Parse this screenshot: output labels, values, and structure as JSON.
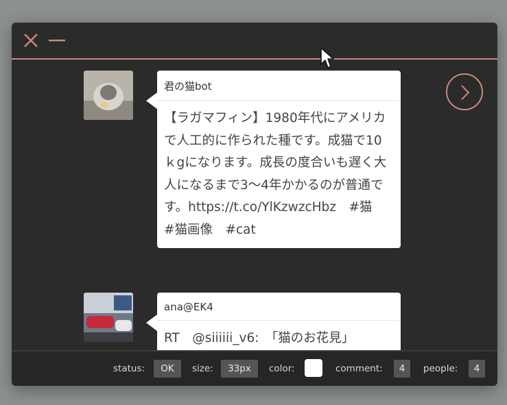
{
  "window": {
    "close_icon": "close-icon",
    "minimize_icon": "minimize-icon",
    "next_icon": "chevron-right-icon"
  },
  "tweets": [
    {
      "author": "君の猫bot",
      "text": "【ラガマフィン】1980年代にアメリカで人工的に作られた種です。成猫で10ｋgになります。成長の度合いも遅く大人になるまで3～4年かかるのが普通です。https://t.co/YlKzwzcHbz　#猫　#猫画像　#cat"
    },
    {
      "author": "ana@EK4",
      "text": "RT　@siiiiii_v6:　「猫のお花見」"
    }
  ],
  "status": {
    "status_label": "status:",
    "status_value": "OK",
    "size_label": "size:",
    "size_value": "33px",
    "color_label": "color:",
    "color_value": "#ffffff",
    "comment_label": "comment:",
    "comment_value": "4",
    "people_label": "people:",
    "people_value": "4"
  },
  "colors": {
    "accent": "#c98a7e",
    "window_bg": "#2b2b2b",
    "desktop_bg": "#8c9090"
  }
}
